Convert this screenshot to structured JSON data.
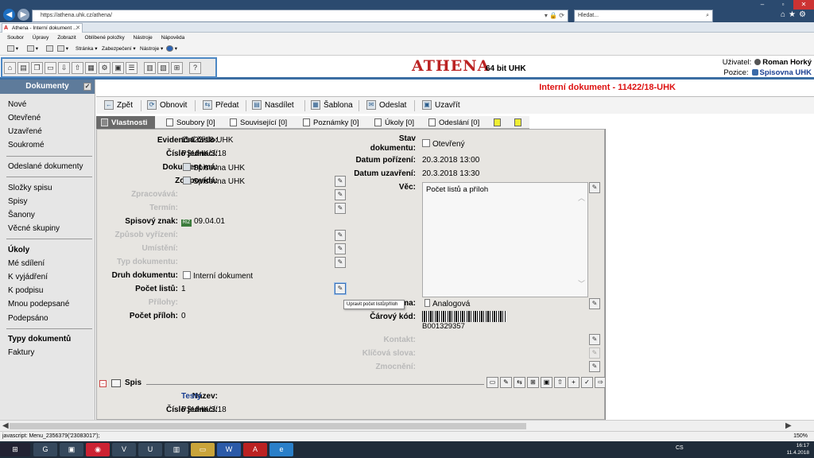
{
  "browser": {
    "url": "https://athena.uhk.cz/athena/",
    "search_placeholder": "Hledat...",
    "tab_title": "Athena - Interní dokument ...",
    "menu": [
      "Soubor",
      "Úpravy",
      "Zobrazit",
      "Oblíbené položky",
      "Nástroje",
      "Nápověda"
    ],
    "commands": [
      "Stránka ▾",
      "Zabezpečení ▾",
      "Nástroje ▾"
    ]
  },
  "app": {
    "logo": "ATHENA",
    "logo_sub": "64 bit UHK",
    "user_label": "Uživatel:",
    "user_name": "Roman Horký",
    "position_label": "Pozice:",
    "position_value": "Spisovna UHK",
    "toolbar_icons": [
      "home-icon",
      "docs-icon",
      "copy-icon",
      "folder-icon",
      "inbox-icon",
      "outbox-icon",
      "grid-icon",
      "settings-icon",
      "archive-icon",
      "stack-icon",
      "calendar-icon",
      "stamp-icon",
      "network-icon",
      "help-icon"
    ]
  },
  "sidebar": {
    "header": "Dokumenty",
    "groups": [
      [
        "Nové",
        "Otevřené",
        "Uzavřené",
        "Soukromé"
      ],
      [
        "Odeslané dokumenty"
      ],
      [
        "Složky spisu",
        "Spisy",
        "Šanony",
        "Věcné skupiny"
      ],
      [
        "Úkoly",
        "Mé sdílení",
        "K vyjádření",
        "K podpisu",
        "Mnou podepsané",
        "Podepsáno"
      ],
      [
        "Typy dokumentů",
        "Faktury"
      ]
    ]
  },
  "document": {
    "title": "Interní dokument - 11422/18-UHK",
    "actions": [
      "Zpět",
      "Obnovit",
      "Předat",
      "Nasdílet",
      "Šablona",
      "Odeslat",
      "Uzavřít"
    ],
    "tabs": [
      "Vlastnosti",
      "Soubory [0]",
      "Související [0]",
      "Poznámky [0]",
      "Úkoly [0]",
      "Odeslání [0]"
    ],
    "fields": {
      "evidencni_cislo_label": "Evidenční číslo:",
      "evidencni_cislo": "11422/18-UHK",
      "cislo_jednaci_label": "Číslo jednací:",
      "cislo_jednaci": "PSUHK/3/18",
      "dokument_ma_label": "Dokument má:",
      "dokument_ma": "Spisovna UHK",
      "zodpovida_label": "Zodpovídá:",
      "zodpovida": "Spisovna UHK",
      "zpracovava_label": "Zpracovává:",
      "termin_label": "Termín:",
      "spisovy_znak_label": "Spisový znak:",
      "spisovy_znak": "09.04.01",
      "spisovy_znak_badge": "RIZ",
      "zpusob_vyrizeni_label": "Způsob vyřízení:",
      "umisteni_label": "Umístění:",
      "typ_dokumentu_label": "Typ dokumentu:",
      "druh_dokumentu_label": "Druh dokumentu:",
      "druh_dokumentu": "Interní dokument",
      "pocet_listu_label": "Počet listů:",
      "pocet_listu": "1",
      "prilohy_label": "Přílohy:",
      "pocet_priloh_label": "Počet příloh:",
      "pocet_priloh": "0",
      "stav_label_1": "Stav",
      "stav_label_2": "dokumentu:",
      "stav": "Otevřený",
      "datum_porizeni_label": "Datum pořízení:",
      "datum_porizeni": "20.3.2018 13:00",
      "datum_uzavreni_label": "Datum uzavření:",
      "datum_uzavreni": "20.3.2018 13:30",
      "vec_label": "Věc:",
      "vec": "Počet listů a příloh",
      "forma_label": "Forma:",
      "forma": "Analogová",
      "carovy_kod_label": "Čárový kód:",
      "carovy_kod": "B001329357",
      "kontakt_label": "Kontakt:",
      "klicova_slova_label": "Klíčová slova:",
      "zmocneni_label": "Zmocnění:"
    },
    "tooltip": "Upravit počet listů/příloh",
    "spis": {
      "header": "Spis",
      "nazev_label": "Název:",
      "nazev": "Testy",
      "cislo_jednaci_label": "Číslo jednací:",
      "cislo_jednaci": "PSUHK/3/18"
    }
  },
  "status": {
    "text": "javascript: Menu_2356379('23083017');",
    "zoom": "150%"
  },
  "taskbar": {
    "lang": "CS",
    "time": "16:17",
    "date": "11.4.2018"
  }
}
